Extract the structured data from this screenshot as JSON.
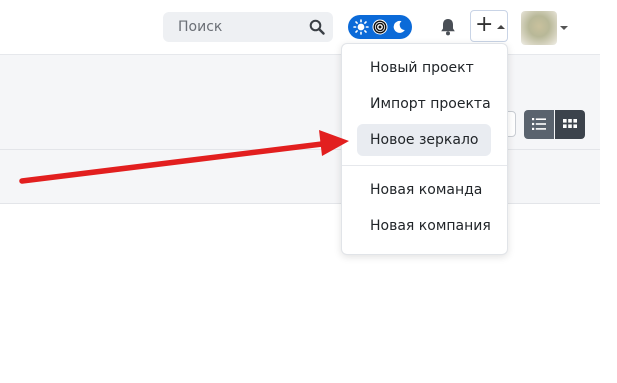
{
  "header": {
    "search": {
      "placeholder": "Поиск",
      "value": ""
    },
    "search_icon": "search-icon",
    "theme_toggle": {
      "icons": [
        "sun-icon",
        "auto-icon",
        "moon-icon"
      ],
      "color": "#0b6ad8"
    },
    "notifications_icon": "bell-icon",
    "create_button": {
      "label": "+",
      "icon": "caret-up-icon"
    },
    "avatar_caret_icon": "caret-down-icon"
  },
  "create_menu": {
    "items": [
      {
        "label": "Новый проект"
      },
      {
        "label": "Импорт проекта"
      },
      {
        "label": "Новое зеркало",
        "highlighted": true
      },
      {
        "label": "Новая команда"
      },
      {
        "label": "Новая компания"
      }
    ]
  },
  "toolbar": {
    "view_modes": [
      {
        "name": "list",
        "icon": "list-icon",
        "active": true
      },
      {
        "name": "grid",
        "icon": "grid-icon",
        "active": false
      }
    ]
  },
  "annotation": {
    "type": "arrow",
    "color": "#e21f1f"
  }
}
